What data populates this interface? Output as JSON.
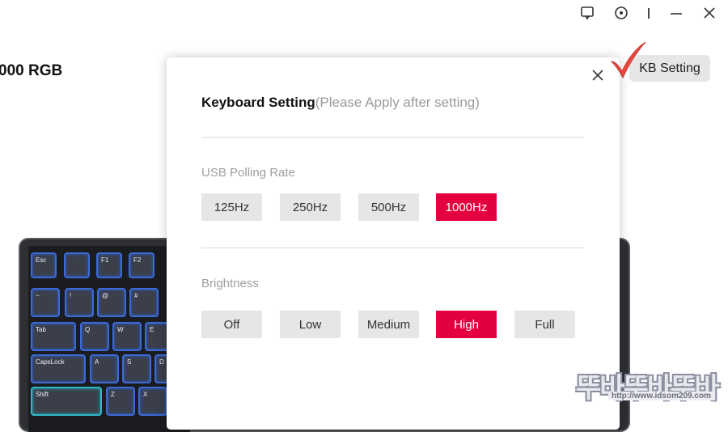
{
  "window": {
    "icons": [
      "feedback-icon",
      "settings-target-icon",
      "divider-bar-icon",
      "minimize-icon",
      "close-icon"
    ]
  },
  "product": {
    "title": "000 RGB"
  },
  "toolbar": {
    "kb_setting_label": "KB Setting"
  },
  "dialog": {
    "title_main": "Keyboard Setting",
    "title_note": "(Please Apply after setting)",
    "polling": {
      "label": "USB Polling Rate",
      "options": [
        "125Hz",
        "250Hz",
        "500Hz",
        "1000Hz"
      ],
      "selected": "1000Hz"
    },
    "brightness": {
      "label": "Brightness",
      "options": [
        "Off",
        "Low",
        "Medium",
        "High",
        "Full"
      ],
      "selected": "High"
    }
  },
  "keyboard": {
    "keys": [
      "Esc",
      "",
      "F1",
      "F2",
      "~",
      "!",
      "@",
      "#",
      "Tab",
      "Q",
      "W",
      "E",
      "CapsLock",
      "A",
      "S",
      "D",
      "Shift",
      "Z",
      "X"
    ]
  },
  "watermark": {
    "text": "뚜바뚜바뚜바",
    "url": "http://www.idsom209.com"
  },
  "colors": {
    "accent": "#e4003f",
    "option_bg": "#e6e6e6",
    "key_glow": "#3c6bd6"
  }
}
